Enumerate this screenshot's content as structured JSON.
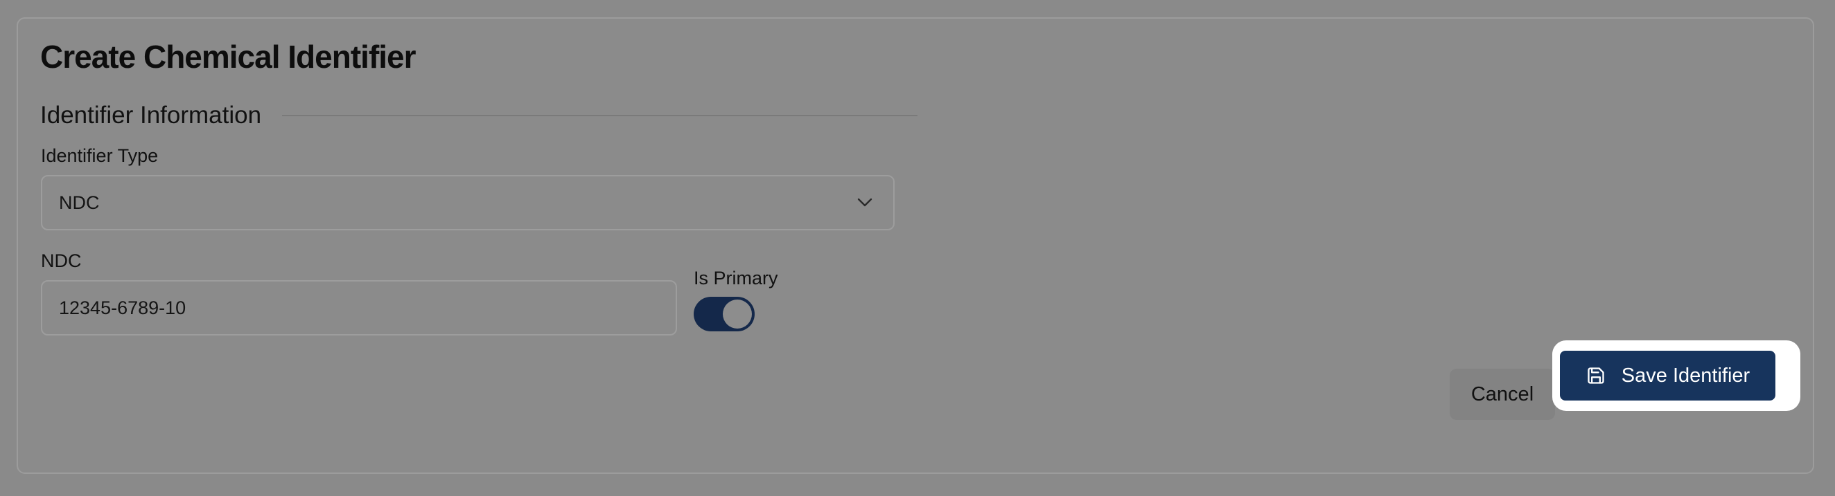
{
  "page": {
    "title": "Create Chemical Identifier"
  },
  "section": {
    "title": "Identifier Information"
  },
  "identifier_type": {
    "label": "Identifier Type",
    "selected_value": "NDC",
    "icon": "chevron-down-icon"
  },
  "ndc": {
    "label": "NDC",
    "value": "12345-6789-10"
  },
  "is_primary": {
    "label": "Is Primary",
    "checked": true
  },
  "actions": {
    "cancel_label": "Cancel",
    "save_label": "Save Identifier",
    "save_icon": "save-icon"
  },
  "colors": {
    "primary": "#17345d",
    "toggle_on": "#14284a",
    "overlay": "#8a8a8a",
    "highlight": "#ffffff"
  }
}
